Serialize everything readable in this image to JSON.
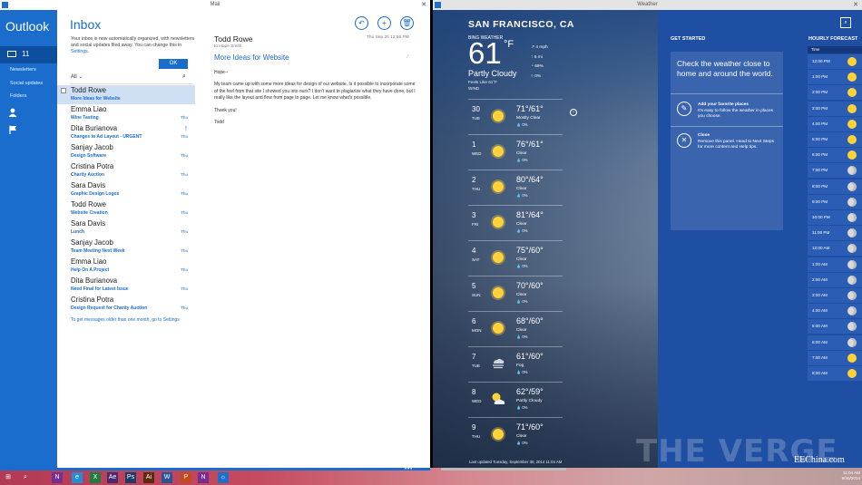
{
  "mail": {
    "window_title": "Mail",
    "brand": "Outlook",
    "unread_count": "11",
    "folders": [
      "Newsletters",
      "Social updates",
      "Folders"
    ],
    "inbox_title": "Inbox",
    "notice": "Your inbox is now automatically organized, with newsletters and social updates filed away. You can change this in",
    "notice_link": "Settings.",
    "ok_label": "OK",
    "filter_label": "All ⌄",
    "messages": [
      {
        "from": "Todd Rowe",
        "subject": "More Ideas for Website",
        "date": "",
        "selected": true
      },
      {
        "from": "Emma Liao",
        "subject": "Wine Tasting",
        "date": "Thu"
      },
      {
        "from": "Dita Burianova",
        "subject": "Changes to Ad Layout - URGENT",
        "date": "Thu",
        "flag": "!"
      },
      {
        "from": "Sanjay Jacob",
        "subject": "Design Software",
        "date": "Thu"
      },
      {
        "from": "Cristina Potra",
        "subject": "Charity Auction",
        "date": "Thu"
      },
      {
        "from": "Sara Davis",
        "subject": "Graphic Design Logos",
        "date": "Thu"
      },
      {
        "from": "Todd Rowe",
        "subject": "Website Creation",
        "date": "Thu"
      },
      {
        "from": "Sara Davis",
        "subject": "Lunch",
        "date": "Thu"
      },
      {
        "from": "Sanjay Jacob",
        "subject": "Team Meeting Next Week",
        "date": "Thu"
      },
      {
        "from": "Emma Liao",
        "subject": "Help On A Project",
        "date": "Thu"
      },
      {
        "from": "Dita Burianova",
        "subject": "Need Final for Latest Issue",
        "date": "Thu"
      },
      {
        "from": "Cristina Potra",
        "subject": "Design Request for Charity Auction",
        "date": "Thu"
      }
    ],
    "older_link": "To get messages older than one month, go to Settings",
    "reader": {
      "from": "Todd Rowe",
      "to": "to Hope Smith",
      "date": "Thu Sep 25     12:56 PM",
      "subject": "More Ideas for Website",
      "greeting": "Hope--",
      "body": "My team came up with some more ideas for design of our website. Is it possible to incorporate some of the feel from that site I showed you into ours? I don't want to plagiarize what they have done, but I really like the layout and flow from page to page. Let me know what's possible.",
      "thanks": "Thank you!",
      "signoff": "Todd"
    }
  },
  "weather": {
    "window_title": "Weather",
    "city": "SAN FRANCISCO, CA",
    "sub": "BING WEATHER",
    "temp": "61",
    "deg": "°F",
    "condition": "Partly Cloudy",
    "feels": "Feels Like 61°F",
    "wind": "WIND",
    "stats": [
      "↗ 4 mph",
      "↑ 6 mi",
      "◔ 69%",
      "○ 0%"
    ],
    "days": [
      {
        "num": "30",
        "day": "TUE",
        "hl": "71°/61°",
        "cond": "Mostly Clear",
        "pct": "💧 0%"
      },
      {
        "num": "1",
        "day": "WED",
        "hl": "76°/61°",
        "cond": "Clear",
        "pct": "💧 0%"
      },
      {
        "num": "2",
        "day": "THU",
        "hl": "80°/64°",
        "cond": "Clear",
        "pct": "💧 0%"
      },
      {
        "num": "3",
        "day": "FRI",
        "hl": "81°/64°",
        "cond": "Clear",
        "pct": "💧 0%"
      },
      {
        "num": "4",
        "day": "SAT",
        "hl": "75°/60°",
        "cond": "Clear",
        "pct": "💧 0%"
      },
      {
        "num": "5",
        "day": "SUN",
        "hl": "70°/60°",
        "cond": "Clear",
        "pct": "💧 0%"
      },
      {
        "num": "6",
        "day": "MON",
        "hl": "68°/60°",
        "cond": "Clear",
        "pct": "💧 0%"
      },
      {
        "num": "7",
        "day": "TUE",
        "hl": "61°/60°",
        "cond": "Fog",
        "pct": "💧 0%"
      },
      {
        "num": "8",
        "day": "WED",
        "hl": "62°/59°",
        "cond": "Partly Cloudy",
        "pct": "💧 0%"
      },
      {
        "num": "9",
        "day": "THU",
        "hl": "71°/60°",
        "cond": "Clear",
        "pct": "💧 0%"
      }
    ],
    "updated": "Last updated Tuesday, September 30, 2014 11:04 AM",
    "get_started": "GET STARTED",
    "gs_big": "Check the weather close to home and around the world.",
    "gs_items": [
      {
        "title": "Add your favorite places",
        "desc": "It's easy to follow the weather in places you choose."
      },
      {
        "title": "Close",
        "desc": "Remove this panel. Head to Next Steps for more content and Help tips."
      }
    ],
    "hourly_title": "HOURLY FORECAST",
    "hourly_col": "Time",
    "hours": [
      "12:00 PM",
      "1:00 PM",
      "2:00 PM",
      "3:00 PM",
      "4:00 PM",
      "5:00 PM",
      "6:00 PM",
      "7:00 PM",
      "8:00 PM",
      "9:00 PM",
      "10:00 PM",
      "11:00 PM",
      "12:00 AM",
      "1:00 AM",
      "2:00 AM",
      "3:00 AM",
      "4:00 AM",
      "5:00 AM",
      "6:00 AM",
      "7:00 AM",
      "8:00 AM"
    ]
  },
  "taskbar": {
    "apps": [
      "⊞",
      "⌕",
      "N",
      "e",
      "X",
      "Ae",
      "Ps",
      "Ai",
      "W",
      "P",
      "N",
      "☼"
    ],
    "time": "11:04 AM",
    "date": "9/30/2014"
  },
  "watermark": "THE VERGE",
  "source": "EEChina.com"
}
